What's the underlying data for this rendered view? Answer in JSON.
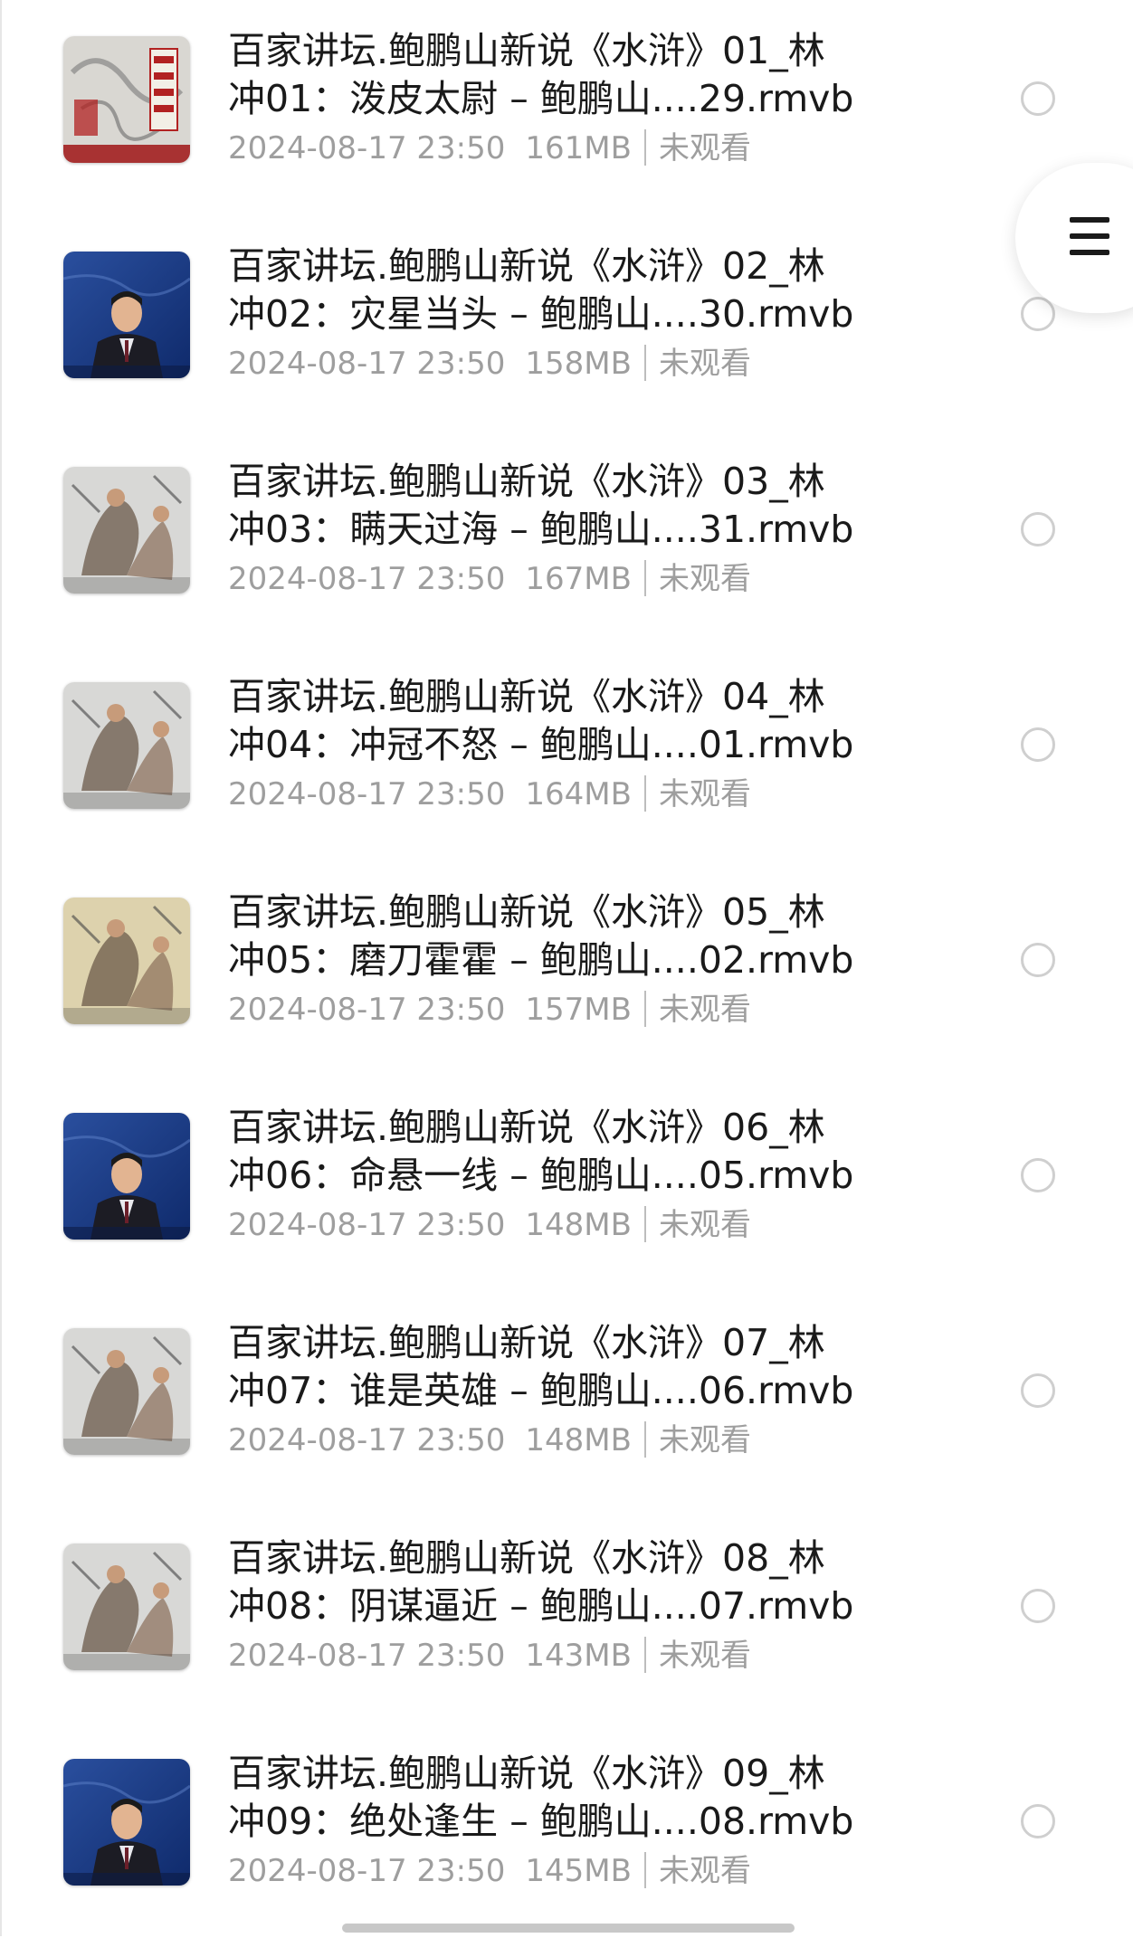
{
  "files": [
    {
      "title_line1": "百家讲坛.鲍鹏山新说《水浒》01_林",
      "title_line2": "冲01：泼皮太尉 – 鲍鹏山....29.rmvb",
      "date": "2024-08-17 23:50",
      "size": "161MB",
      "status": "未观看",
      "thumb": "calligraphy"
    },
    {
      "title_line1": "百家讲坛.鲍鹏山新说《水浒》02_林",
      "title_line2": "冲02：灾星当头 – 鲍鹏山....30.rmvb",
      "date": "2024-08-17 23:50",
      "size": "158MB",
      "status": "未观看",
      "thumb": "speaker"
    },
    {
      "title_line1": "百家讲坛.鲍鹏山新说《水浒》03_林",
      "title_line2": "冲03：瞒天过海 – 鲍鹏山....31.rmvb",
      "date": "2024-08-17 23:50",
      "size": "167MB",
      "status": "未观看",
      "thumb": "painting"
    },
    {
      "title_line1": "百家讲坛.鲍鹏山新说《水浒》04_林",
      "title_line2": "冲04：冲冠不怒 – 鲍鹏山....01.rmvb",
      "date": "2024-08-17 23:50",
      "size": "164MB",
      "status": "未观看",
      "thumb": "painting"
    },
    {
      "title_line1": "百家讲坛.鲍鹏山新说《水浒》05_林",
      "title_line2": "冲05：磨刀霍霍 – 鲍鹏山....02.rmvb",
      "date": "2024-08-17 23:50",
      "size": "157MB",
      "status": "未观看",
      "thumb": "painting-warm"
    },
    {
      "title_line1": "百家讲坛.鲍鹏山新说《水浒》06_林",
      "title_line2": "冲06：命悬一线 – 鲍鹏山....05.rmvb",
      "date": "2024-08-17 23:50",
      "size": "148MB",
      "status": "未观看",
      "thumb": "speaker"
    },
    {
      "title_line1": "百家讲坛.鲍鹏山新说《水浒》07_林",
      "title_line2": "冲07：谁是英雄 – 鲍鹏山....06.rmvb",
      "date": "2024-08-17 23:50",
      "size": "148MB",
      "status": "未观看",
      "thumb": "painting"
    },
    {
      "title_line1": "百家讲坛.鲍鹏山新说《水浒》08_林",
      "title_line2": "冲08：阴谋逼近 – 鲍鹏山....07.rmvb",
      "date": "2024-08-17 23:50",
      "size": "143MB",
      "status": "未观看",
      "thumb": "painting"
    },
    {
      "title_line1": "百家讲坛.鲍鹏山新说《水浒》09_林",
      "title_line2": "冲09：绝处逢生 – 鲍鹏山....08.rmvb",
      "date": "2024-08-17 23:50",
      "size": "145MB",
      "status": "未观看",
      "thumb": "speaker"
    }
  ],
  "menu_button": {
    "icon": "hamburger-menu-icon"
  },
  "colors": {
    "title": "#1a1a1a",
    "meta": "#9e9e9e",
    "radio_border": "#cfcfcf"
  }
}
